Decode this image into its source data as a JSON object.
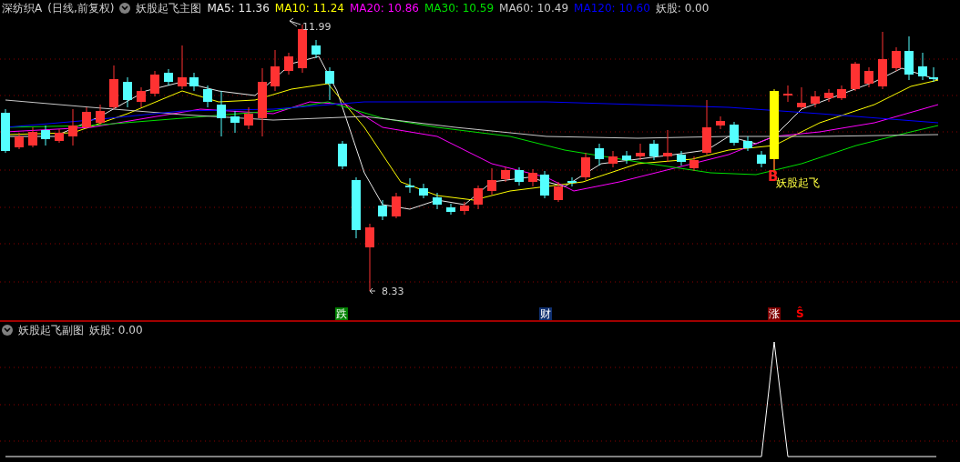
{
  "main_header": {
    "stock": "深纺织A",
    "period": "(日线,前复权)",
    "indicator": "妖股起飞主图",
    "moving_averages": [
      {
        "label": "MA5:",
        "value": "11.36",
        "color": "#e8e8e8"
      },
      {
        "label": "MA10:",
        "value": "11.24",
        "color": "#ffff00"
      },
      {
        "label": "MA20:",
        "value": "10.86",
        "color": "#ff00ff"
      },
      {
        "label": "MA30:",
        "value": "10.59",
        "color": "#00e000"
      },
      {
        "label": "MA60:",
        "value": "10.49",
        "color": "#c8c8c8"
      },
      {
        "label": "MA120:",
        "value": "10.60",
        "color": "#0000ff"
      }
    ],
    "signal": "妖股: 0.00"
  },
  "price_labels": [
    {
      "kind": "high",
      "text": "11.99"
    },
    {
      "kind": "low",
      "text": "8.33"
    }
  ],
  "buy_signal": {
    "letter": "B",
    "text": "妖股起飞"
  },
  "event_markers": [
    {
      "kind": "tag",
      "text": "跌",
      "color": "#008000"
    },
    {
      "kind": "tag",
      "text": "财",
      "color": "#103070"
    },
    {
      "kind": "tag",
      "text": "涨",
      "color": "#800000"
    },
    {
      "kind": "plain",
      "text": "Ŝ",
      "color": "#ff0000"
    }
  ],
  "sub_header": {
    "indicator": "妖股起飞副图",
    "signal": "妖股: 0.00"
  }
}
